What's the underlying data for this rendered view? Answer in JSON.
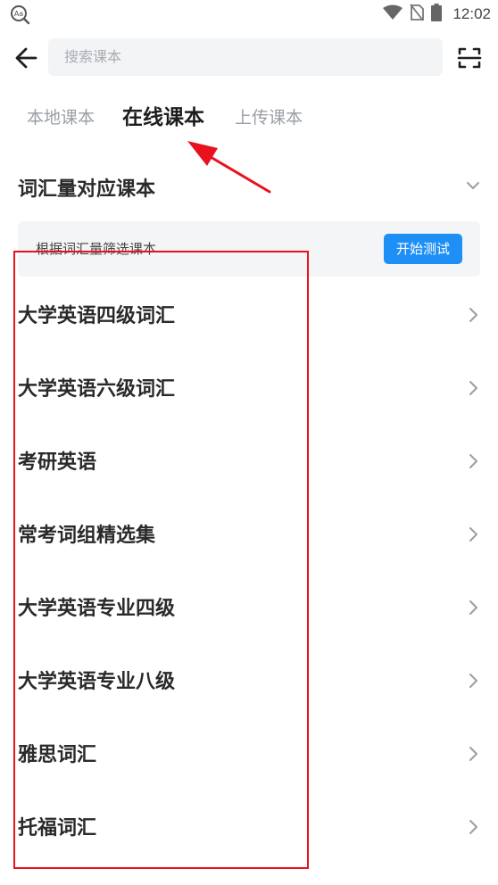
{
  "status_bar": {
    "time": "12:02",
    "left_icon": "text-size-icon",
    "right_icons": [
      "wifi-icon",
      "no-sim-icon",
      "battery-icon"
    ]
  },
  "top_bar": {
    "back_icon": "arrow-left-icon",
    "search_placeholder": "搜索课本",
    "scan_icon": "scan-icon"
  },
  "tabs": [
    {
      "label": "本地课本",
      "active": false
    },
    {
      "label": "在线课本",
      "active": true
    },
    {
      "label": "上传课本",
      "active": false
    }
  ],
  "section": {
    "title": "词汇量对应课本",
    "chevron_icon": "chevron-down-icon"
  },
  "filter_card": {
    "text": "根据词汇量筛选课本",
    "button_label": "开始测试"
  },
  "books": [
    {
      "label": "大学英语四级词汇"
    },
    {
      "label": "大学英语六级词汇"
    },
    {
      "label": "考研英语"
    },
    {
      "label": "常考词组精选集"
    },
    {
      "label": "大学英语专业四级"
    },
    {
      "label": "大学英语专业八级"
    },
    {
      "label": "雅思词汇"
    },
    {
      "label": "托福词汇"
    }
  ],
  "colors": {
    "accent": "#1e8ff5",
    "annotation_red": "#e8121e",
    "muted_text": "#9a9ea5",
    "primary_text": "#2a2a2a"
  }
}
